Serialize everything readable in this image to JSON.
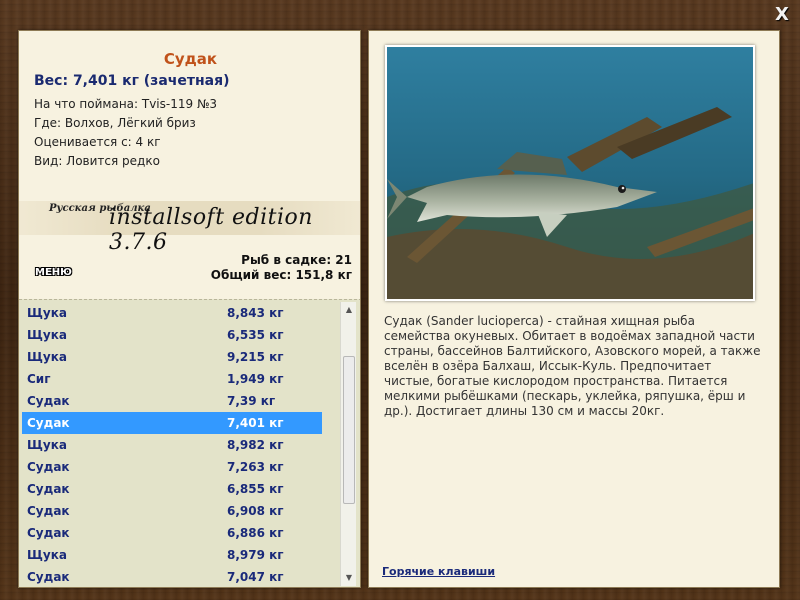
{
  "window": {
    "close_label": "X"
  },
  "fish": {
    "name": "Судак",
    "weight_line": "Вес: 7,401 кг (зачетная)",
    "caught_on": "На что поймана: Tvis-119 №3",
    "where": "Где: Волхов, Лёгкий бриз",
    "valued_from": "Оценивается с: 4 кг",
    "rarity": "Вид: Ловится редко"
  },
  "banner": {
    "small": "Русская рыбалка",
    "big": "installsoft edition 3.7.6"
  },
  "menu_label": "МЕНЮ",
  "stats": {
    "count_line": "Рыб в садке: 21",
    "total_line": "Общий вес: 151,8 кг"
  },
  "catch_list": [
    {
      "name": "Щука",
      "weight": "8,843 кг"
    },
    {
      "name": "Щука",
      "weight": "6,535 кг"
    },
    {
      "name": "Щука",
      "weight": "9,215 кг"
    },
    {
      "name": "Сиг",
      "weight": "1,949 кг"
    },
    {
      "name": "Судак",
      "weight": "7,39 кг"
    },
    {
      "name": "Судак",
      "weight": "7,401 кг",
      "selected": true
    },
    {
      "name": "Щука",
      "weight": "8,982 кг"
    },
    {
      "name": "Судак",
      "weight": "7,263 кг"
    },
    {
      "name": "Судак",
      "weight": "6,855 кг"
    },
    {
      "name": "Судак",
      "weight": "6,908 кг"
    },
    {
      "name": "Судак",
      "weight": "6,886 кг"
    },
    {
      "name": "Щука",
      "weight": "8,979 кг"
    },
    {
      "name": "Судак",
      "weight": "7,047 кг"
    }
  ],
  "description": "Судак (Sander lucioperca) - стайная хищная рыба семейства окуневых. Обитает в водоёмах западной части страны, бассейнов Балтийского, Азовского морей, а также вселён в озёра Балхаш, Иссык-Куль. Предпочитает чистые, богатые кислородом пространства. Питается мелкими рыбёшками (пескарь, уклейка, ряпушка, ёрш и др.). Достигает длины 130 см и массы 20кг.",
  "hotkeys_label": "Горячие клавиши",
  "colors": {
    "selected_row": "#3399ff",
    "title": "#c0521a",
    "list_text": "#1a2a7a"
  }
}
